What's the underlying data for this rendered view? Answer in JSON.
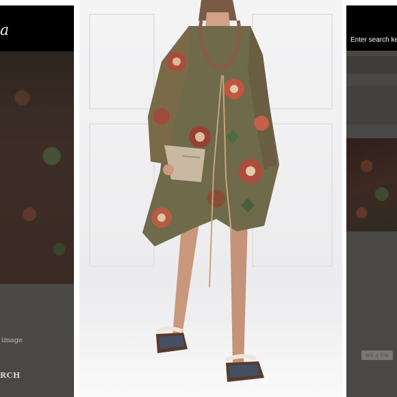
{
  "left_panel": {
    "logo_text": "a",
    "image_label": "image",
    "search_label": "RCH"
  },
  "right_panel": {
    "search": {
      "placeholder": "Enter search ke"
    },
    "tell_friend_label": "tell a frie"
  },
  "product_photo": {
    "subject": "model-in-printed-chiffon-dress",
    "colors": {
      "dress_green": "#6e6a4a",
      "dress_red": "#b5473a",
      "bag": "#c9b8a2",
      "skin": "#c9977b"
    }
  },
  "colors": {
    "overlay": "#4a4847",
    "topbar": "#000000",
    "background": "#ffffff"
  }
}
